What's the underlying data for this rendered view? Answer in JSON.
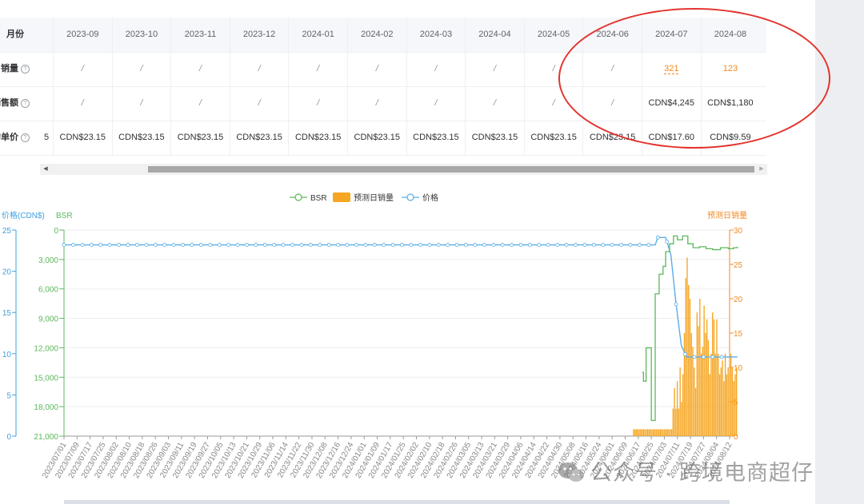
{
  "table": {
    "months_label": "月份",
    "months": [
      "2023-09",
      "2023-10",
      "2023-11",
      "2023-12",
      "2024-01",
      "2024-02",
      "2024-03",
      "2024-04",
      "2024-05",
      "2024-06",
      "2024-07",
      "2024-08"
    ],
    "rows": [
      {
        "label": "月销量",
        "values": [
          "/",
          "/",
          "/",
          "/",
          "/",
          "/",
          "/",
          "/",
          "/",
          "/",
          "321",
          "123"
        ]
      },
      {
        "label": "销售额",
        "values": [
          "/",
          "/",
          "/",
          "/",
          "/",
          "/",
          "/",
          "/",
          "/",
          "/",
          "CDN$4,245",
          "CDN$1,180"
        ]
      },
      {
        "label": "均单价",
        "values": [
          "CDN$23.15",
          "CDN$23.15",
          "CDN$23.15",
          "CDN$23.15",
          "CDN$23.15",
          "CDN$23.15",
          "CDN$23.15",
          "CDN$23.15",
          "CDN$23.15",
          "CDN$23.15",
          "CDN$17.60",
          "CDN$9.59"
        ]
      }
    ],
    "partial_prefix": "5",
    "help_symbol": "?"
  },
  "chart_data": {
    "type": "line",
    "legend": [
      "BSR",
      "预测日销量",
      "价格"
    ],
    "legend_position": "top-center",
    "axes": {
      "price": {
        "label": "价格(CDN$)",
        "min": 0,
        "max": 25,
        "ticks": [
          0,
          5,
          10,
          15,
          20,
          25
        ],
        "color": "#3fa0e0"
      },
      "bsr": {
        "label": "BSR",
        "min": 0,
        "max": 21000,
        "inverted": true,
        "ticks": [
          0,
          3000,
          6000,
          9000,
          12000,
          15000,
          18000,
          21000
        ],
        "tick_labels": [
          "0",
          "3,000",
          "6,000",
          "9,000",
          "12,000",
          "15,000",
          "18,000",
          "21,000"
        ],
        "color": "#5cb85c"
      },
      "sales": {
        "label": "预测日销量",
        "min": 0,
        "max": 30,
        "ticks": [
          0,
          5,
          10,
          15,
          20,
          25,
          30
        ],
        "color": "#f08a24"
      }
    },
    "x_labels": [
      "2023/07/01",
      "2023/07/09",
      "2023/07/17",
      "2023/07/25",
      "2023/08/02",
      "2023/08/10",
      "2023/08/18",
      "2023/08/26",
      "2023/09/03",
      "2023/09/11",
      "2023/09/19",
      "2023/09/27",
      "2023/10/05",
      "2023/10/13",
      "2023/10/21",
      "2023/10/29",
      "2023/11/06",
      "2023/11/14",
      "2023/11/22",
      "2023/11/30",
      "2023/12/08",
      "2023/12/16",
      "2023/12/24",
      "2024/01/01",
      "2024/01/09",
      "2024/01/17",
      "2024/01/25",
      "2024/02/02",
      "2024/02/10",
      "2024/02/18",
      "2024/02/26",
      "2024/03/05",
      "2024/03/13",
      "2024/03/21",
      "2024/03/29",
      "2024/04/06",
      "2024/04/14",
      "2024/04/22",
      "2024/04/30",
      "2024/05/08",
      "2024/05/16",
      "2024/05/24",
      "2024/06/01",
      "2024/06/09",
      "2024/06/17",
      "2024/06/25",
      "2024/07/03",
      "2024/07/11",
      "2024/07/19",
      "2024/07/27",
      "2024/08/04",
      "2024/08/12"
    ],
    "price_series": {
      "name": "价格",
      "points": [
        [
          0,
          23.2
        ],
        [
          45.3,
          23.2
        ],
        [
          45.5,
          24.1
        ],
        [
          46.1,
          24.1
        ],
        [
          46.5,
          22.0
        ],
        [
          46.9,
          16.0
        ],
        [
          47.3,
          11.0
        ],
        [
          47.7,
          9.6
        ],
        [
          51.6,
          9.6
        ]
      ]
    },
    "bsr_series": {
      "name": "BSR",
      "points": [
        [
          44.3,
          14500
        ],
        [
          44.4,
          15400
        ],
        [
          44.6,
          12000
        ],
        [
          44.9,
          12000
        ],
        [
          45.0,
          19400
        ],
        [
          45.3,
          6500
        ],
        [
          45.6,
          4500
        ],
        [
          45.9,
          3700
        ],
        [
          46.1,
          2200
        ],
        [
          46.4,
          1400
        ],
        [
          46.7,
          600
        ],
        [
          47.0,
          1000
        ],
        [
          47.4,
          600
        ],
        [
          47.8,
          1400
        ],
        [
          48.2,
          1800
        ],
        [
          48.7,
          1700
        ],
        [
          49.2,
          1900
        ],
        [
          49.7,
          2000
        ],
        [
          50.3,
          1800
        ],
        [
          50.9,
          1900
        ],
        [
          51.3,
          1800
        ],
        [
          51.6,
          1700
        ]
      ]
    },
    "sales_series": {
      "name": "预测日销量",
      "values": [
        1,
        1,
        1,
        1,
        1,
        1,
        1,
        1,
        1,
        1,
        1,
        1,
        1,
        1,
        1,
        1,
        1,
        1,
        1,
        1,
        1,
        1,
        1,
        1,
        1,
        1,
        1,
        1,
        4,
        7,
        4,
        8,
        4,
        10,
        5,
        9,
        15,
        23,
        26,
        22,
        20,
        15,
        13,
        10,
        7,
        18,
        16,
        20,
        12,
        13,
        19,
        15,
        17,
        14,
        9,
        12,
        18,
        17,
        12,
        17,
        12,
        9,
        10,
        11,
        8,
        12,
        9,
        10,
        9,
        12,
        10,
        8,
        9,
        10
      ]
    },
    "sales_start_index": 43.6,
    "sales_end_index": 51.6
  },
  "watermark": "公众号 · 跨境电商超仔"
}
